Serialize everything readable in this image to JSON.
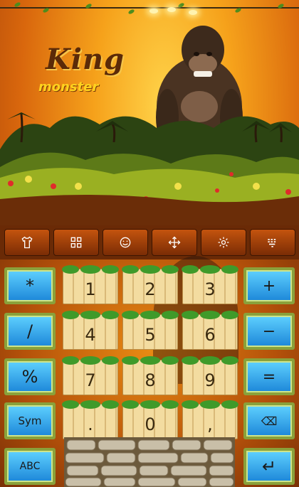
{
  "title": {
    "king": "King",
    "monster": "monster"
  },
  "toolbar": {
    "items": [
      {
        "name": "shirt-icon",
        "label": ""
      },
      {
        "name": "grid-icon",
        "label": ""
      },
      {
        "name": "smiley-icon",
        "label": ""
      },
      {
        "name": "move-arrows-icon",
        "label": ""
      },
      {
        "name": "gear-icon",
        "label": ""
      },
      {
        "name": "keyboard-icon",
        "label": ""
      }
    ]
  },
  "keys": {
    "left": [
      "*",
      "/",
      "%",
      "Sym",
      "ABC"
    ],
    "right": [
      "+",
      "−",
      "=",
      "⌫",
      "↵"
    ],
    "digits": [
      [
        "1",
        "2",
        "3"
      ],
      [
        "4",
        "5",
        "6"
      ],
      [
        "7",
        "8",
        "9"
      ],
      [
        ".",
        "0",
        ","
      ]
    ]
  },
  "colors": {
    "toolbar_bg": "#6a2a06",
    "blue_key": "#1c86d8",
    "wood_key": "#f3dca0",
    "title_brown": "#5b2a08",
    "title_yellow": "#ffd21e"
  }
}
